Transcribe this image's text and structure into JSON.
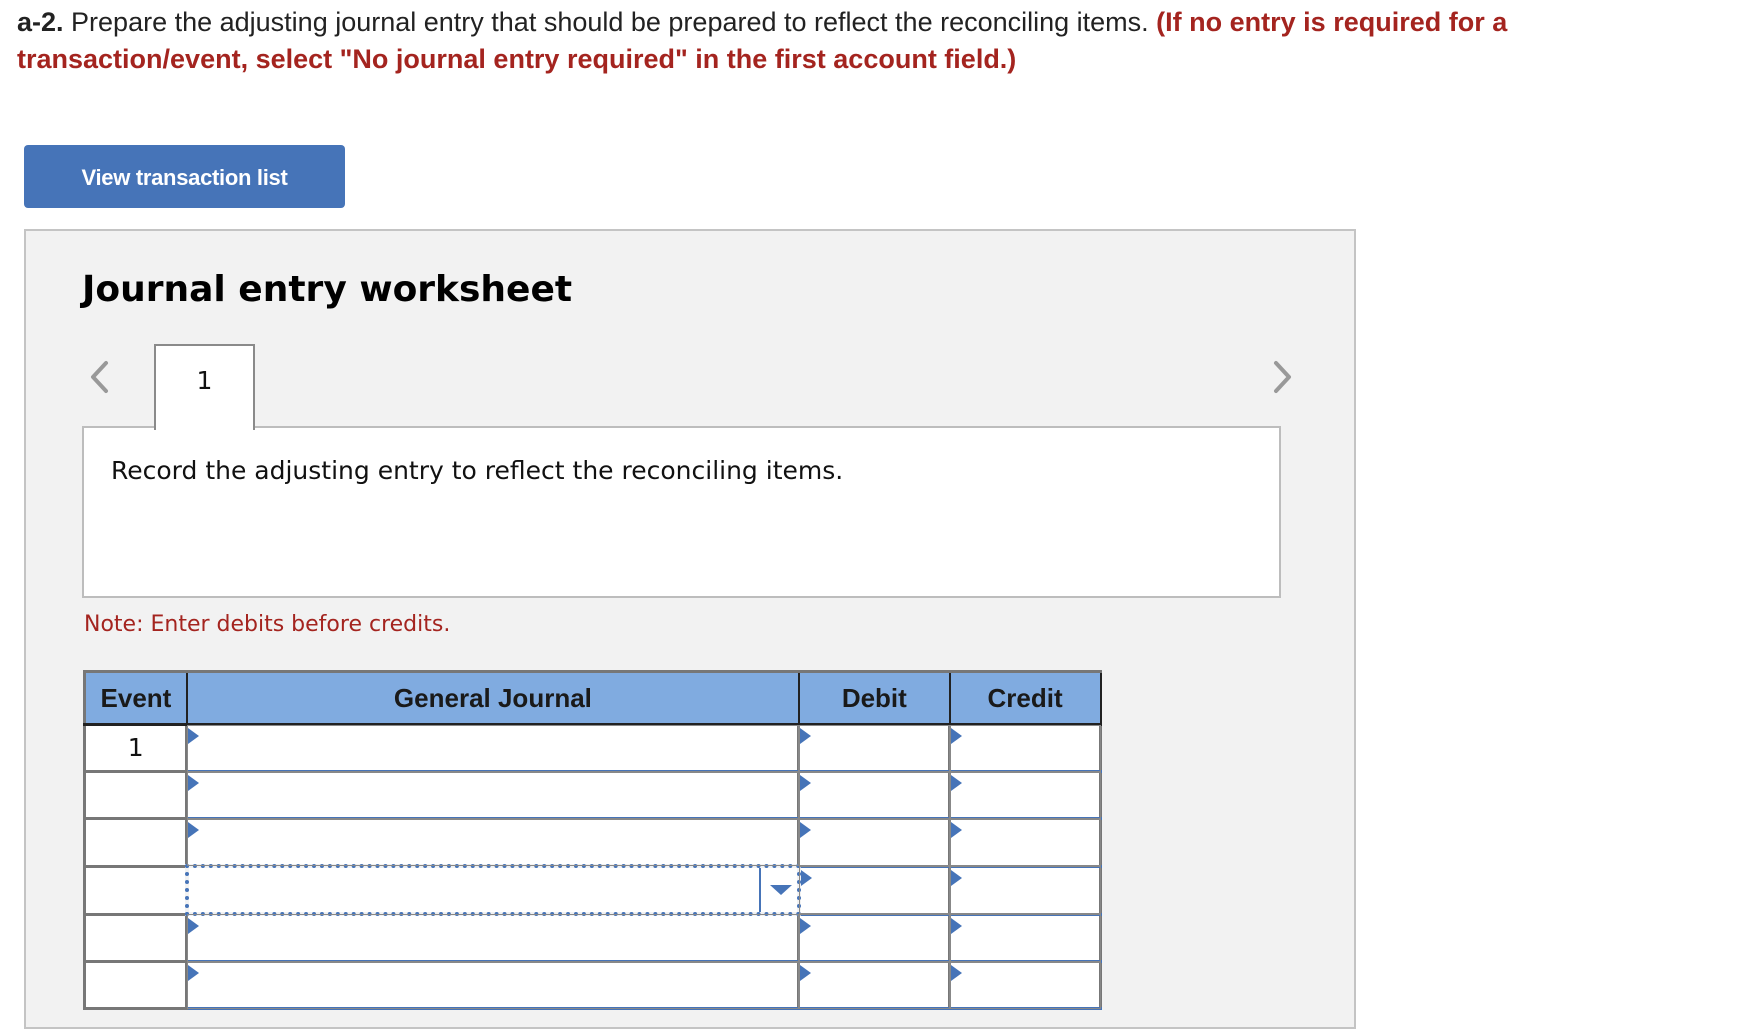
{
  "instructions": {
    "label": "a-2.",
    "text": " Prepare the adjusting journal entry that should be prepared to reflect the reconciling items. ",
    "emphasis_line1": "(If no entry is required for a",
    "emphasis_line2": "transaction/event, select \"No journal entry required\" in the first account field.)"
  },
  "view_transaction_button": "View transaction list",
  "worksheet": {
    "title": "Journal entry worksheet",
    "prev_icon": "chevron-left-icon",
    "next_icon": "chevron-right-icon",
    "tabs": [
      {
        "label": "1",
        "active": true
      }
    ],
    "description": "Record the adjusting entry to reflect the reconciling items.",
    "note": "Note: Enter debits before credits."
  },
  "journal_table": {
    "columns": [
      "Event",
      "General Journal",
      "Debit",
      "Credit"
    ],
    "rows": [
      {
        "event": "1",
        "account": "",
        "debit": "",
        "credit": ""
      },
      {
        "event": "",
        "account": "",
        "debit": "",
        "credit": ""
      },
      {
        "event": "",
        "account": "",
        "debit": "",
        "credit": ""
      },
      {
        "event": "",
        "account": "",
        "debit": "",
        "credit": "",
        "focused": true
      },
      {
        "event": "",
        "account": "",
        "debit": "",
        "credit": ""
      },
      {
        "event": "",
        "account": "",
        "debit": "",
        "credit": ""
      }
    ]
  },
  "colors": {
    "accent_blue": "#4674b8",
    "header_blue": "#80abe0",
    "emphasis_red": "#a4241f",
    "panel_gray": "#f2f2f2"
  }
}
